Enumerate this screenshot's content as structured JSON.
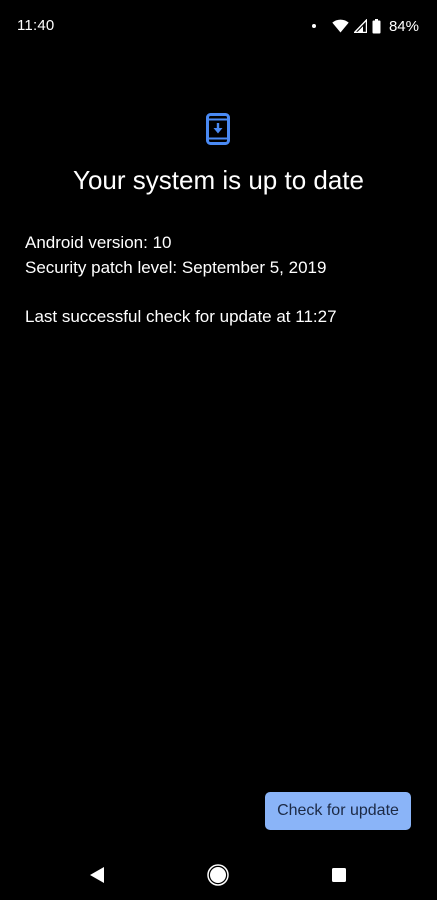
{
  "status_bar": {
    "time": "11:40",
    "battery_percent": "84%",
    "icons": [
      "notification-dot-icon",
      "wifi-icon",
      "cell-signal-icon",
      "battery-icon"
    ]
  },
  "update_screen": {
    "icon": "system-update-icon",
    "title": "Your system is up to date",
    "android_version": "Android version: 10",
    "security_patch": "Security patch level: September 5, 2019",
    "last_check": "Last successful check for update at 11:27",
    "check_button_label": "Check for update"
  },
  "navigation": {
    "buttons": [
      "back-icon",
      "home-icon",
      "recents-icon"
    ]
  },
  "colors": {
    "background": "#000000",
    "accent": "#8ab4f8",
    "icon_blue": "#4a8af4",
    "text": "#ffffff",
    "button_text": "#1c2a45"
  }
}
